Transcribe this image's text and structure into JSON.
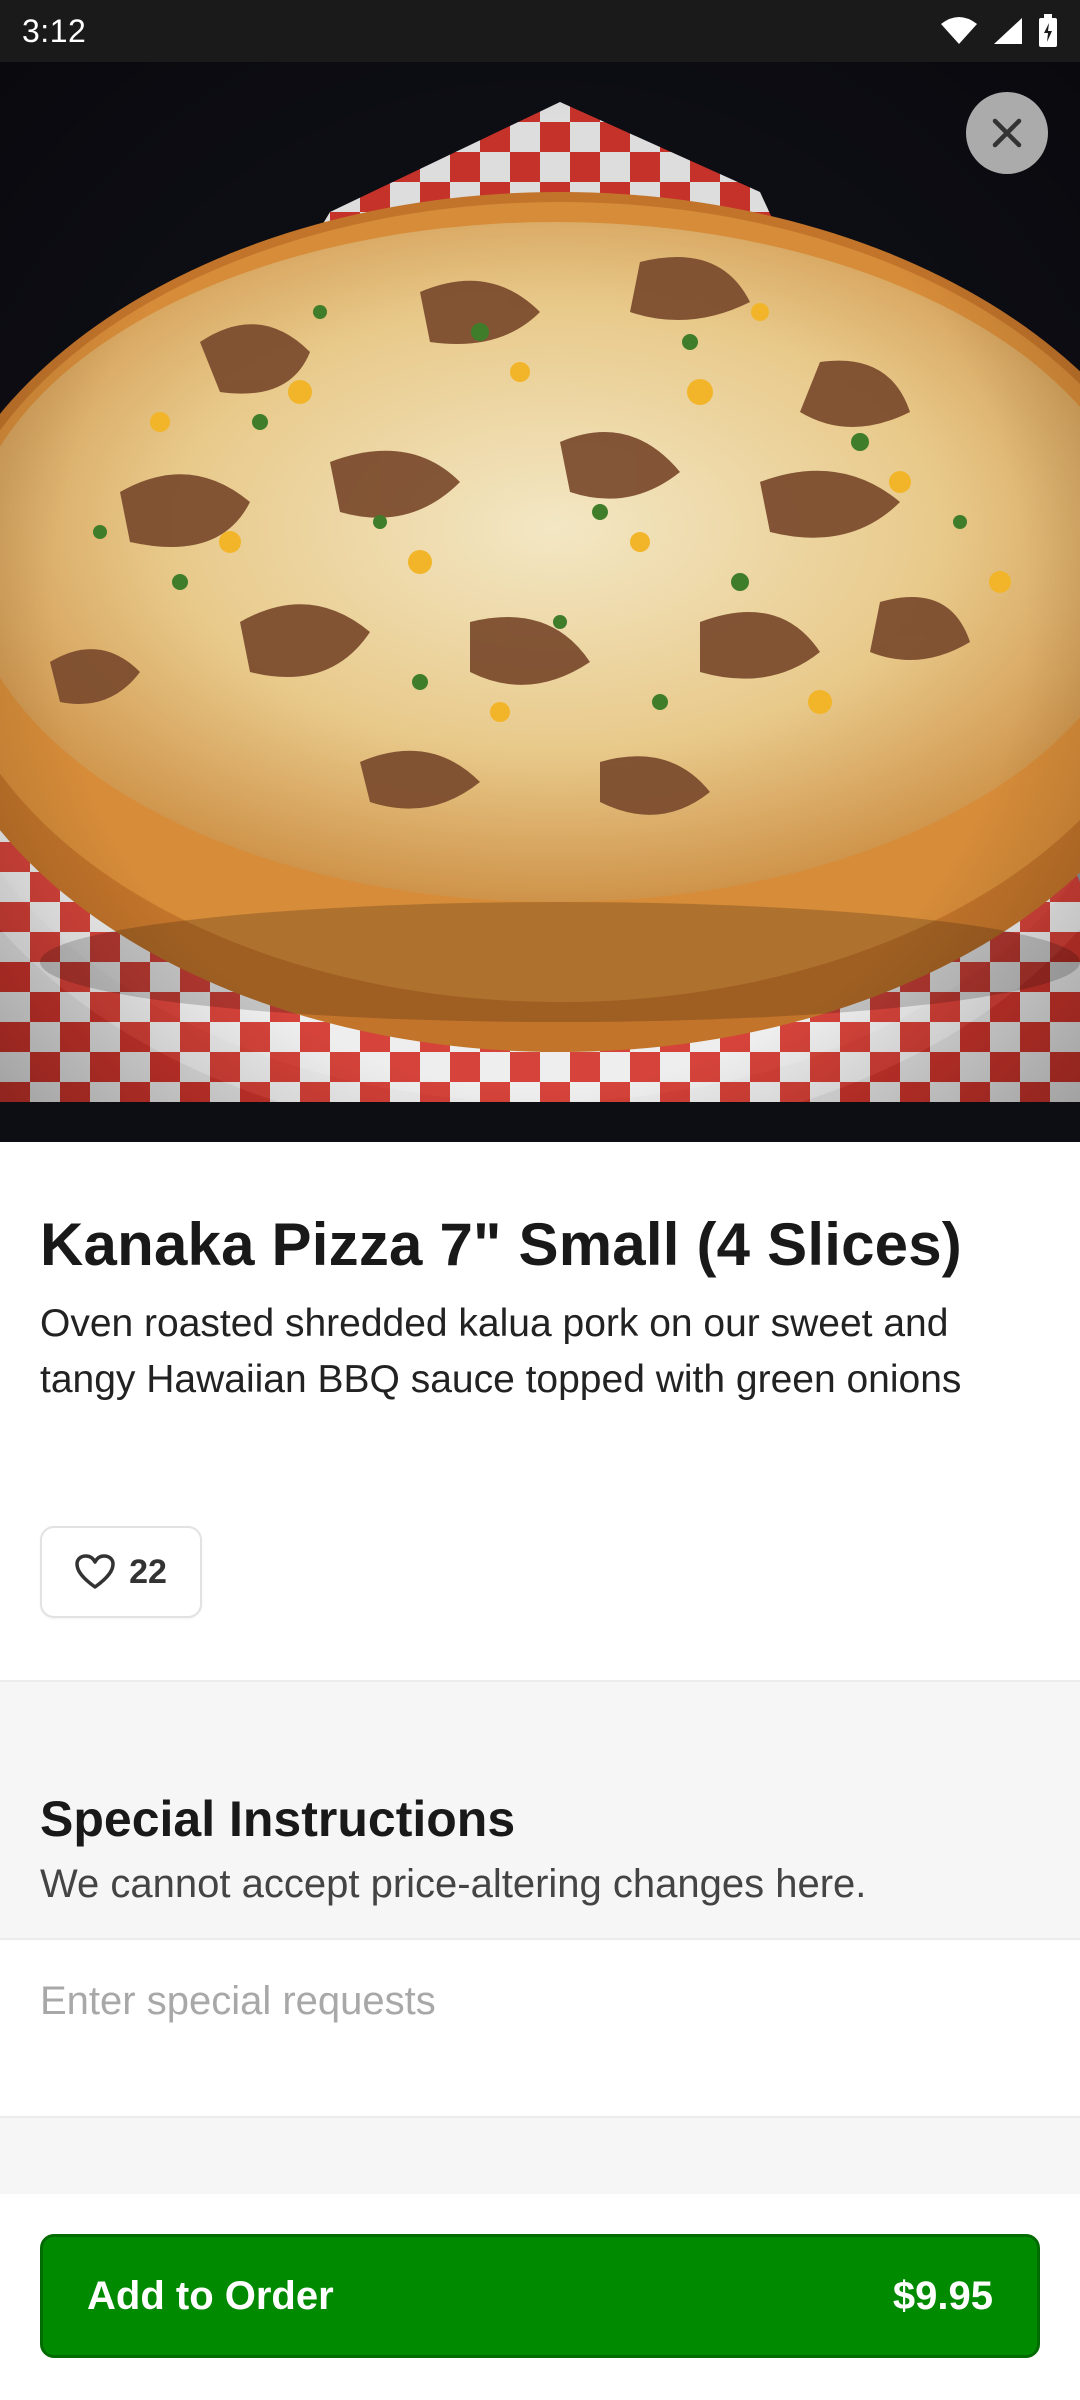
{
  "status_bar": {
    "time": "3:12",
    "icons": [
      "wifi-icon",
      "signal-icon",
      "battery-icon"
    ]
  },
  "header": {
    "close_icon": "close-icon",
    "hero_image": "Kanaka pizza photo"
  },
  "item": {
    "title": "Kanaka Pizza 7\" Small (4 Slices)",
    "description": "Oven roasted shredded kalua pork on our sweet and tangy Hawaiian BBQ sauce topped with green onions",
    "likes": "22"
  },
  "special_instructions": {
    "title": "Special Instructions",
    "subtitle": "We cannot accept price-altering changes here.",
    "placeholder": "Enter special requests",
    "value": ""
  },
  "footer": {
    "add_label": "Add to Order",
    "price": "$9.95"
  },
  "colors": {
    "primary": "#008a00",
    "background": "#ffffff",
    "band": "#f6f6f6"
  }
}
